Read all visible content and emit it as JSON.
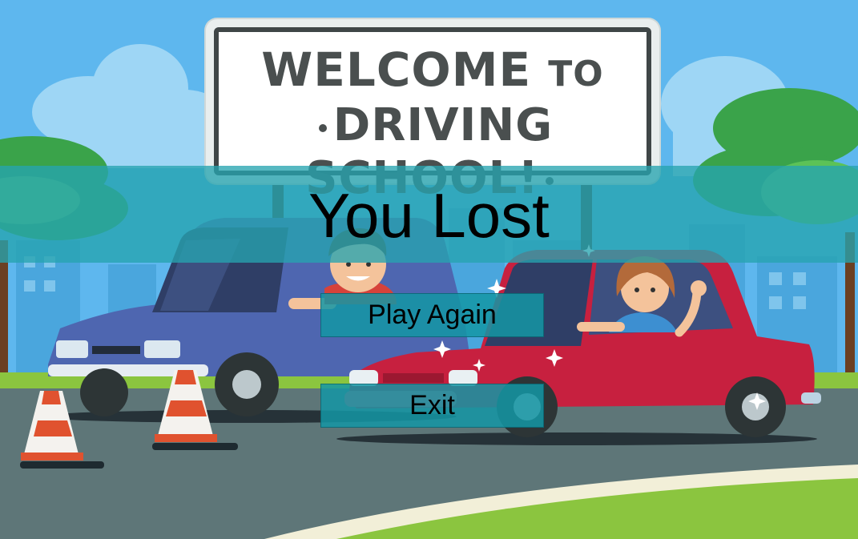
{
  "sign": {
    "line1_main": "WELCOME",
    "line1_small": "TO",
    "line2": "DRIVING SCHOOL!"
  },
  "status": {
    "title": "You Lost"
  },
  "menu": {
    "play_again_label": "Play Again",
    "exit_label": "Exit"
  },
  "colors": {
    "sky": "#5eb7ee",
    "banner": "#26a4b0",
    "button": "#1496a5",
    "blue_car": "#4e66b0",
    "red_car": "#c7203f",
    "grass": "#8bc53f"
  }
}
